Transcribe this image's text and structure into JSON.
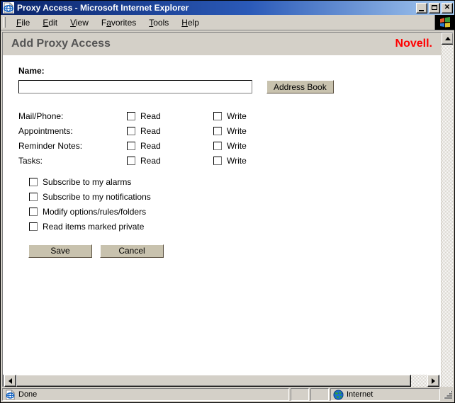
{
  "window": {
    "title": "Proxy Access - Microsoft Internet Explorer",
    "icon": "ie-document-icon",
    "controls": {
      "minimize": "_",
      "maximize": "□",
      "close": "✕"
    }
  },
  "menubar": {
    "items": [
      {
        "label": "File",
        "accel": "F"
      },
      {
        "label": "Edit",
        "accel": "E"
      },
      {
        "label": "View",
        "accel": "V"
      },
      {
        "label": "Favorites",
        "accel": "a"
      },
      {
        "label": "Tools",
        "accel": "T"
      },
      {
        "label": "Help",
        "accel": "H"
      }
    ],
    "logo_icon": "ie-animated-logo-icon"
  },
  "page": {
    "header": {
      "title": "Add Proxy Access",
      "brand": "Novell."
    },
    "name_field": {
      "label": "Name:",
      "value": "",
      "placeholder": ""
    },
    "address_book_button": "Address Book",
    "permissions": {
      "rows": [
        {
          "name": "Mail/Phone:",
          "read_label": "Read",
          "read_checked": false,
          "write_label": "Write",
          "write_checked": false
        },
        {
          "name": "Appointments:",
          "read_label": "Read",
          "read_checked": false,
          "write_label": "Write",
          "write_checked": false
        },
        {
          "name": "Reminder Notes:",
          "read_label": "Read",
          "read_checked": false,
          "write_label": "Write",
          "write_checked": false
        },
        {
          "name": "Tasks:",
          "read_label": "Read",
          "read_checked": false,
          "write_label": "Write",
          "write_checked": false
        }
      ]
    },
    "options": [
      {
        "label": "Subscribe to my alarms",
        "checked": false
      },
      {
        "label": "Subscribe to my notifications",
        "checked": false
      },
      {
        "label": "Modify options/rules/folders",
        "checked": false
      },
      {
        "label": "Read items marked private",
        "checked": false
      }
    ],
    "actions": {
      "save": "Save",
      "cancel": "Cancel"
    }
  },
  "statusbar": {
    "status_text": "Done",
    "status_icon": "ie-document-icon",
    "zone_text": "Internet",
    "zone_icon": "globe-icon"
  },
  "colors": {
    "brand_red": "#ff0000",
    "header_text": "#555555",
    "face": "#d4d0c8",
    "button_face": "#c8c2ae",
    "titlebar_start": "#0a246a",
    "titlebar_end": "#a6caf0"
  }
}
